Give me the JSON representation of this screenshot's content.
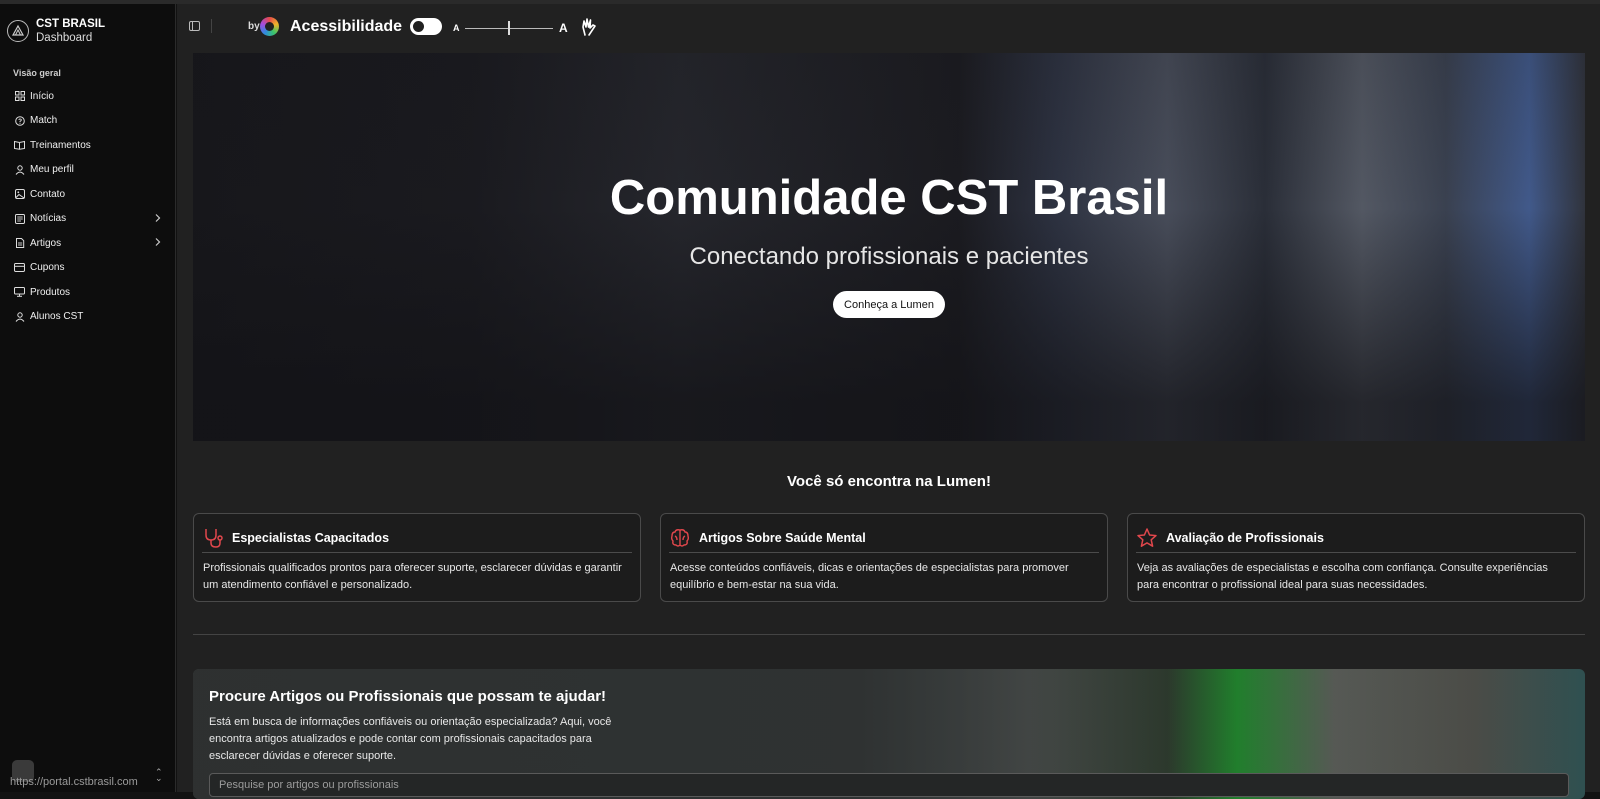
{
  "sidebar": {
    "brand_name": "CST BRASIL",
    "brand_sub": "Dashboard",
    "section_label": "Visão geral",
    "items": [
      {
        "label": "Início",
        "icon": "grid-icon"
      },
      {
        "label": "Match",
        "icon": "help-circle-icon"
      },
      {
        "label": "Treinamentos",
        "icon": "book-open-icon"
      },
      {
        "label": "Meu perfil",
        "icon": "user-icon"
      },
      {
        "label": "Contato",
        "icon": "image-icon"
      },
      {
        "label": "Notícias",
        "icon": "newspaper-icon",
        "submenu": true
      },
      {
        "label": "Artigos",
        "icon": "file-text-icon",
        "submenu": true
      },
      {
        "label": "Cupons",
        "icon": "credit-card-icon"
      },
      {
        "label": "Produtos",
        "icon": "monitor-icon"
      },
      {
        "label": "Alunos CST",
        "icon": "user-icon"
      }
    ],
    "status_url": "https://portal.cstbrasil.com"
  },
  "topbar": {
    "by_label": "by",
    "accessibility_title": "Acessibilidade",
    "font_small": "A",
    "font_large": "A"
  },
  "hero": {
    "title": "Comunidade CST Brasil",
    "subtitle": "Conectando profissionais e pacientes",
    "cta": "Conheça a Lumen"
  },
  "features": {
    "title": "Você só encontra na Lumen!",
    "cards": [
      {
        "title": "Especialistas Capacitados",
        "icon": "stethoscope-icon",
        "text": "Profissionais qualificados prontos para oferecer suporte, esclarecer dúvidas e garantir um atendimento confiável e personalizado."
      },
      {
        "title": "Artigos Sobre Saúde Mental",
        "icon": "brain-icon",
        "text": "Acesse conteúdos confiáveis, dicas e orientações de especialistas para promover equilíbrio e bem-estar na sua vida."
      },
      {
        "title": "Avaliação de Profissionais",
        "icon": "star-icon",
        "text": "Veja as avaliações de especialistas e escolha com confiança. Consulte experiências para encontrar o profissional ideal para suas necessidades."
      }
    ]
  },
  "search": {
    "title": "Procure Artigos ou Profissionais que possam te ajudar!",
    "text": "Está em busca de informações confiáveis ou orientação especializada? Aqui, você encontra artigos atualizados e pode contar com profissionais capacitados para esclarecer dúvidas e oferecer suporte.",
    "placeholder": "Pesquise por artigos ou profissionais"
  },
  "colors": {
    "accent_icon": "#e0474c",
    "background": "#212121",
    "sidebar": "#0d0d0d"
  }
}
